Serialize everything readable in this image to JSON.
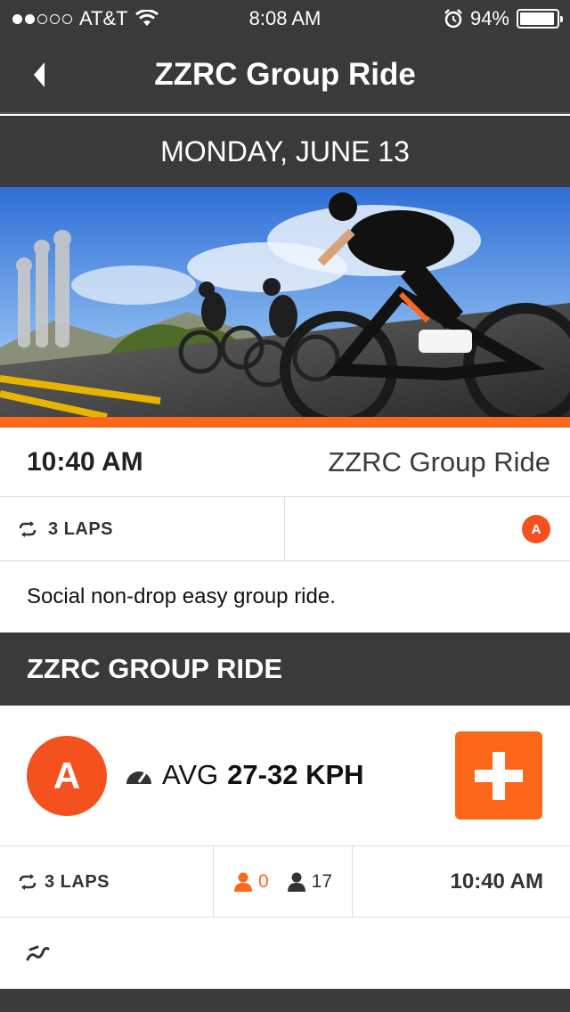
{
  "status_bar": {
    "carrier": "AT&T",
    "signal_bars_filled": 2,
    "signal_bars_total": 5,
    "time": "8:08 AM",
    "battery": "94%"
  },
  "nav": {
    "title": "ZZRC Group Ride"
  },
  "date": "MONDAY, JUNE 13",
  "event": {
    "time": "10:40 AM",
    "name": "ZZRC Group Ride",
    "laps": "3 LAPS",
    "category": "A",
    "description": "Social non-drop easy group ride."
  },
  "section": {
    "title": "ZZRC GROUP RIDE"
  },
  "group": {
    "category": "A",
    "avg_label": "AVG",
    "avg_value": "27-32 KPH",
    "laps": "3 LAPS",
    "riders_following": "0",
    "riders_signed_up": "17",
    "time": "10:40 AM"
  },
  "colors": {
    "accent": "#fc6719",
    "category_badge": "#f4511e",
    "header_bg": "#3a3a3a"
  },
  "icons": {
    "back": "chevron-left-icon",
    "laps": "repeat-icon",
    "speed": "speedometer-icon",
    "join": "plus-icon",
    "rider": "person-icon",
    "route": "route-icon"
  }
}
